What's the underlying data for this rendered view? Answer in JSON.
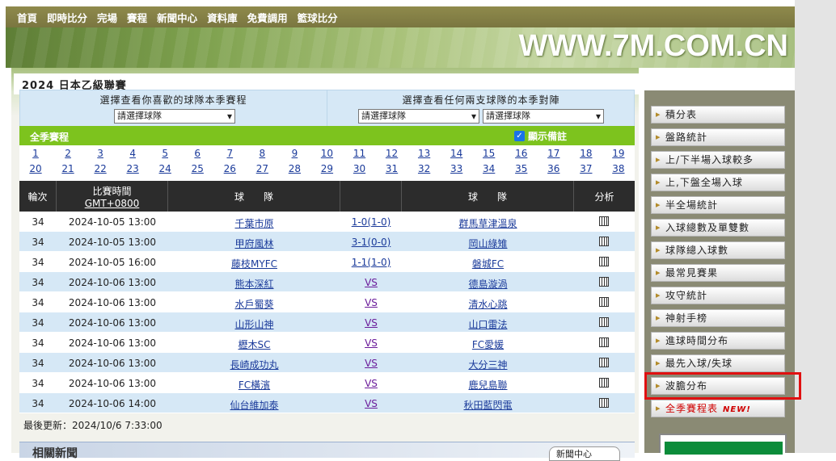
{
  "nav": {
    "items": [
      "首頁",
      "即時比分",
      "完場",
      "賽程",
      "新聞中心",
      "資料庫",
      "免費調用",
      "籃球比分"
    ]
  },
  "banner": {
    "url_text": "WWW.7M.COM.CN"
  },
  "league": {
    "title": "2024 日本乙級聯賽"
  },
  "selectors": {
    "left_heading": "選擇查看你喜歡的球隊本季賽程",
    "right_heading": "選擇查看任何兩支球隊的本季對陣",
    "placeholder": "請選擇球隊"
  },
  "season": {
    "label": "全季賽程",
    "remark_label": "顯示備註",
    "remark_checked": true
  },
  "rounds": [
    "1",
    "2",
    "3",
    "4",
    "5",
    "6",
    "7",
    "8",
    "9",
    "10",
    "11",
    "12",
    "13",
    "14",
    "15",
    "16",
    "17",
    "18",
    "19",
    "20",
    "21",
    "22",
    "23",
    "24",
    "25",
    "26",
    "27",
    "28",
    "29",
    "30",
    "31",
    "32",
    "33",
    "34",
    "35",
    "36",
    "37",
    "38"
  ],
  "table": {
    "headers": {
      "round": "輪次",
      "time": "比賽時間",
      "tz": "GMT+0800",
      "home": "球　　隊",
      "away": "球　　隊",
      "analysis": "分析"
    },
    "rows": [
      {
        "round": "34",
        "time": "2024-10-05 13:00",
        "home": "千葉市原",
        "score": "1-0(1-0)",
        "away": "群馬草津溫泉"
      },
      {
        "round": "34",
        "time": "2024-10-05 13:00",
        "home": "甲府風林",
        "score": "3-1(0-0)",
        "away": "岡山綠雉"
      },
      {
        "round": "34",
        "time": "2024-10-05 16:00",
        "home": "藤枝MYFC",
        "score": "1-1(1-0)",
        "away": "磐城FC"
      },
      {
        "round": "34",
        "time": "2024-10-06 13:00",
        "home": "熊本深紅",
        "score": "VS",
        "away": "德島漩渦"
      },
      {
        "round": "34",
        "time": "2024-10-06 13:00",
        "home": "水戶蜀葵",
        "score": "VS",
        "away": "清水心跳"
      },
      {
        "round": "34",
        "time": "2024-10-06 13:00",
        "home": "山形山神",
        "score": "VS",
        "away": "山口雷法"
      },
      {
        "round": "34",
        "time": "2024-10-06 13:00",
        "home": "櫪木SC",
        "score": "VS",
        "away": "FC愛媛"
      },
      {
        "round": "34",
        "time": "2024-10-06 13:00",
        "home": "長崎成功丸",
        "score": "VS",
        "away": "大分三神"
      },
      {
        "round": "34",
        "time": "2024-10-06 13:00",
        "home": "FC橫濱",
        "score": "VS",
        "away": "鹿兒島聯"
      },
      {
        "round": "34",
        "time": "2024-10-06 14:00",
        "home": "仙台維加泰",
        "score": "VS",
        "away": "秋田藍閃電"
      }
    ]
  },
  "last_update": "最後更新：2024/10/6 7:33:00",
  "news": {
    "title": "相關新聞",
    "more": "新聞中心"
  },
  "sidebar": {
    "items": [
      "積分表",
      "盤路統計",
      "上/下半場入球較多",
      "上,下盤全場入球",
      "半全場統計",
      "入球總數及單雙數",
      "球隊總入球數",
      "最常見賽果",
      "攻守統計",
      "神射手榜",
      "進球時間分布",
      "最先入球/失球",
      "波膽分布",
      "全季賽程表"
    ],
    "new_badge": "NEW!"
  },
  "colors": {
    "nav_bg": "#8f8a4c",
    "season_green": "#7dc31e",
    "table_header": "#2c2c2c",
    "row_odd": "#ffffff",
    "row_even": "#d6e8f6",
    "link": "#1a3a9a",
    "highlight": "#e01010"
  }
}
